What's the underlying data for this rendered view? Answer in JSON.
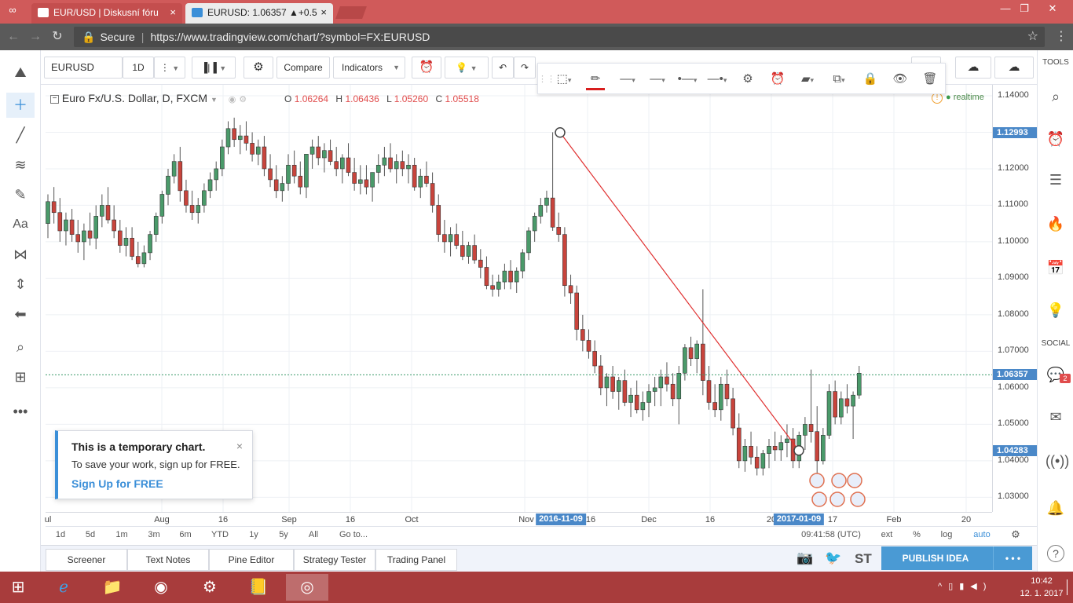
{
  "browser": {
    "tabs": [
      {
        "title": "EUR/USD | Diskusní fóru",
        "close": "×"
      },
      {
        "title": "EURUSD: 1.06357 ▲+0.5",
        "close": "×"
      }
    ],
    "address": {
      "secure_label": "Secure",
      "url": "https://www.tradingview.com/chart/?symbol=FX:EURUSD"
    }
  },
  "toolbar": {
    "symbol": "EURUSD",
    "interval": "1D",
    "compare_label": "Compare",
    "indicators_label": "Indicators"
  },
  "legend": {
    "title": "Euro Fx/U.S. Dollar, D, FXCM",
    "o_label": "O",
    "o": "1.06264",
    "h_label": "H",
    "h": "1.06436",
    "l_label": "L",
    "l": "1.05260",
    "c_label": "C",
    "c": "1.05518",
    "realtime": "realtime"
  },
  "price_scale": {
    "ticks": [
      "1.14000",
      "1.12000",
      "1.11000",
      "1.10000",
      "1.09000",
      "1.08000",
      "1.07000",
      "1.06000",
      "1.05000",
      "1.04000",
      "1.03000"
    ],
    "badges": [
      {
        "label": "1.12993",
        "value": 1.12993,
        "color": "#4a88c8"
      },
      {
        "label": "1.06357",
        "value": 1.06357,
        "color": "#4a88c8"
      },
      {
        "label": "1.04283",
        "value": 1.04283,
        "color": "#4a88c8"
      }
    ]
  },
  "time_scale": {
    "labels": [
      "ul",
      "Aug",
      "16",
      "Sep",
      "16",
      "Oct",
      "Nov",
      "16",
      "Dec",
      "16",
      "20",
      "17",
      "Feb",
      "20"
    ],
    "badges": [
      "2016-11-09",
      "2017-01-09"
    ]
  },
  "popup": {
    "title": "This is a temporary chart.",
    "body": "To save your work, sign up for FREE.",
    "link": "Sign Up for FREE",
    "close": "×"
  },
  "range_bar": {
    "buttons": [
      "1d",
      "5d",
      "1m",
      "3m",
      "6m",
      "YTD",
      "1y",
      "5y",
      "All",
      "Go to..."
    ],
    "time": "09:41:58 (UTC)",
    "options": [
      "ext",
      "%",
      "log",
      "auto"
    ]
  },
  "bottom_tabs": [
    "Screener",
    "Text Notes",
    "Pine Editor",
    "Strategy Tester",
    "Trading Panel"
  ],
  "bottom_right": {
    "st": "ST",
    "publish": "PUBLISH IDEA",
    "more": "• • •"
  },
  "right_sidebar": {
    "tools_label": "TOOLS",
    "social_label": "SOCIAL",
    "chat_badge": "2"
  },
  "taskbar": {
    "time": "10:42",
    "date": "12. 1. 2017"
  },
  "chart_data": {
    "type": "candlestick",
    "title": "Euro Fx/U.S. Dollar, D, FXCM",
    "ylim": [
      1.026,
      1.143
    ],
    "last_price": 1.06357,
    "trendline": {
      "from": {
        "date": "2016-11-09",
        "price": 1.12993
      },
      "to": {
        "date": "2017-01-09",
        "price": 1.04283
      }
    },
    "candles": [
      [
        1.105,
        1.113,
        1.101,
        1.111
      ],
      [
        1.111,
        1.115,
        1.105,
        1.108
      ],
      [
        1.108,
        1.112,
        1.1,
        1.103
      ],
      [
        1.103,
        1.108,
        1.099,
        1.106
      ],
      [
        1.106,
        1.109,
        1.1,
        1.102
      ],
      [
        1.102,
        1.106,
        1.097,
        1.1
      ],
      [
        1.1,
        1.105,
        1.095,
        1.103
      ],
      [
        1.103,
        1.108,
        1.099,
        1.101
      ],
      [
        1.101,
        1.11,
        1.098,
        1.107
      ],
      [
        1.107,
        1.113,
        1.104,
        1.11
      ],
      [
        1.11,
        1.115,
        1.105,
        1.106
      ],
      [
        1.106,
        1.11,
        1.101,
        1.103
      ],
      [
        1.103,
        1.106,
        1.097,
        1.099
      ],
      [
        1.099,
        1.104,
        1.096,
        1.101
      ],
      [
        1.101,
        1.104,
        1.095,
        1.096
      ],
      [
        1.096,
        1.1,
        1.093,
        1.094
      ],
      [
        1.094,
        1.099,
        1.093,
        1.097
      ],
      [
        1.097,
        1.103,
        1.095,
        1.102
      ],
      [
        1.102,
        1.108,
        1.1,
        1.107
      ],
      [
        1.107,
        1.114,
        1.105,
        1.113
      ],
      [
        1.113,
        1.12,
        1.11,
        1.118
      ],
      [
        1.118,
        1.124,
        1.116,
        1.122
      ],
      [
        1.122,
        1.126,
        1.111,
        1.114
      ],
      [
        1.114,
        1.117,
        1.108,
        1.11
      ],
      [
        1.11,
        1.114,
        1.106,
        1.108
      ],
      [
        1.108,
        1.112,
        1.105,
        1.11
      ],
      [
        1.11,
        1.116,
        1.108,
        1.114
      ],
      [
        1.114,
        1.119,
        1.112,
        1.117
      ],
      [
        1.117,
        1.122,
        1.114,
        1.12
      ],
      [
        1.12,
        1.128,
        1.118,
        1.126
      ],
      [
        1.126,
        1.133,
        1.124,
        1.131
      ],
      [
        1.131,
        1.134,
        1.126,
        1.128
      ],
      [
        1.128,
        1.132,
        1.124,
        1.129
      ],
      [
        1.129,
        1.133,
        1.125,
        1.127
      ],
      [
        1.127,
        1.13,
        1.122,
        1.124
      ],
      [
        1.124,
        1.128,
        1.121,
        1.126
      ],
      [
        1.126,
        1.129,
        1.118,
        1.12
      ],
      [
        1.12,
        1.124,
        1.115,
        1.117
      ],
      [
        1.117,
        1.121,
        1.112,
        1.114
      ],
      [
        1.114,
        1.118,
        1.111,
        1.116
      ],
      [
        1.116,
        1.124,
        1.114,
        1.121
      ],
      [
        1.121,
        1.125,
        1.116,
        1.118
      ],
      [
        1.118,
        1.122,
        1.113,
        1.115
      ],
      [
        1.115,
        1.12,
        1.112,
        1.124
      ],
      [
        1.124,
        1.128,
        1.12,
        1.126
      ],
      [
        1.126,
        1.129,
        1.121,
        1.123
      ],
      [
        1.123,
        1.127,
        1.119,
        1.125
      ],
      [
        1.125,
        1.128,
        1.121,
        1.122
      ],
      [
        1.122,
        1.126,
        1.118,
        1.12
      ],
      [
        1.12,
        1.124,
        1.116,
        1.123
      ],
      [
        1.123,
        1.127,
        1.118,
        1.119
      ],
      [
        1.119,
        1.123,
        1.114,
        1.116
      ],
      [
        1.116,
        1.121,
        1.113,
        1.117
      ],
      [
        1.117,
        1.121,
        1.113,
        1.115
      ],
      [
        1.115,
        1.119,
        1.111,
        1.119
      ],
      [
        1.119,
        1.124,
        1.116,
        1.121
      ],
      [
        1.121,
        1.126,
        1.118,
        1.123
      ],
      [
        1.123,
        1.127,
        1.119,
        1.12
      ],
      [
        1.12,
        1.124,
        1.116,
        1.122
      ],
      [
        1.122,
        1.125,
        1.118,
        1.12
      ],
      [
        1.12,
        1.124,
        1.116,
        1.121
      ],
      [
        1.121,
        1.123,
        1.114,
        1.115
      ],
      [
        1.115,
        1.12,
        1.112,
        1.118
      ],
      [
        1.118,
        1.122,
        1.115,
        1.116
      ],
      [
        1.116,
        1.119,
        1.108,
        1.11
      ],
      [
        1.11,
        1.113,
        1.1,
        1.102
      ],
      [
        1.102,
        1.106,
        1.097,
        1.1
      ],
      [
        1.1,
        1.104,
        1.096,
        1.102
      ],
      [
        1.102,
        1.105,
        1.098,
        1.099
      ],
      [
        1.099,
        1.103,
        1.095,
        1.096
      ],
      [
        1.096,
        1.1,
        1.094,
        1.099
      ],
      [
        1.099,
        1.102,
        1.094,
        1.095
      ],
      [
        1.095,
        1.098,
        1.09,
        1.093
      ],
      [
        1.093,
        1.096,
        1.087,
        1.088
      ],
      [
        1.088,
        1.091,
        1.085,
        1.087
      ],
      [
        1.087,
        1.091,
        1.085,
        1.089
      ],
      [
        1.089,
        1.094,
        1.087,
        1.092
      ],
      [
        1.092,
        1.095,
        1.087,
        1.089
      ],
      [
        1.089,
        1.093,
        1.086,
        1.092
      ],
      [
        1.092,
        1.098,
        1.09,
        1.097
      ],
      [
        1.097,
        1.104,
        1.095,
        1.103
      ],
      [
        1.103,
        1.108,
        1.1,
        1.107
      ],
      [
        1.107,
        1.112,
        1.105,
        1.11
      ],
      [
        1.11,
        1.114,
        1.108,
        1.112
      ],
      [
        1.112,
        1.13,
        1.103,
        1.104
      ],
      [
        1.104,
        1.108,
        1.1,
        1.102
      ],
      [
        1.102,
        1.104,
        1.085,
        1.088
      ],
      [
        1.088,
        1.091,
        1.083,
        1.086
      ],
      [
        1.086,
        1.088,
        1.073,
        1.076
      ],
      [
        1.076,
        1.08,
        1.07,
        1.073
      ],
      [
        1.073,
        1.076,
        1.068,
        1.07
      ],
      [
        1.07,
        1.073,
        1.064,
        1.066
      ],
      [
        1.066,
        1.069,
        1.058,
        1.06
      ],
      [
        1.06,
        1.064,
        1.055,
        1.063
      ],
      [
        1.063,
        1.066,
        1.057,
        1.059
      ],
      [
        1.059,
        1.063,
        1.054,
        1.062
      ],
      [
        1.062,
        1.065,
        1.055,
        1.056
      ],
      [
        1.056,
        1.06,
        1.052,
        1.058
      ],
      [
        1.058,
        1.062,
        1.053,
        1.054
      ],
      [
        1.054,
        1.059,
        1.051,
        1.056
      ],
      [
        1.056,
        1.061,
        1.052,
        1.059
      ],
      [
        1.059,
        1.063,
        1.055,
        1.06
      ],
      [
        1.06,
        1.065,
        1.055,
        1.063
      ],
      [
        1.063,
        1.067,
        1.059,
        1.061
      ],
      [
        1.061,
        1.064,
        1.055,
        1.057
      ],
      [
        1.057,
        1.066,
        1.05,
        1.064
      ],
      [
        1.064,
        1.072,
        1.062,
        1.071
      ],
      [
        1.071,
        1.074,
        1.066,
        1.068
      ],
      [
        1.068,
        1.073,
        1.064,
        1.072
      ],
      [
        1.072,
        1.087,
        1.058,
        1.062
      ],
      [
        1.062,
        1.066,
        1.054,
        1.056
      ],
      [
        1.056,
        1.061,
        1.052,
        1.054
      ],
      [
        1.054,
        1.063,
        1.051,
        1.061
      ],
      [
        1.061,
        1.065,
        1.055,
        1.057
      ],
      [
        1.057,
        1.06,
        1.047,
        1.049
      ],
      [
        1.049,
        1.053,
        1.038,
        1.04
      ],
      [
        1.04,
        1.046,
        1.037,
        1.044
      ],
      [
        1.044,
        1.048,
        1.039,
        1.041
      ],
      [
        1.041,
        1.044,
        1.036,
        1.038
      ],
      [
        1.038,
        1.043,
        1.036,
        1.042
      ],
      [
        1.042,
        1.046,
        1.038,
        1.044
      ],
      [
        1.044,
        1.048,
        1.04,
        1.043
      ],
      [
        1.043,
        1.047,
        1.04,
        1.045
      ],
      [
        1.045,
        1.05,
        1.041,
        1.046
      ],
      [
        1.046,
        1.049,
        1.038,
        1.04
      ],
      [
        1.04,
        1.048,
        1.038,
        1.047
      ],
      [
        1.047,
        1.052,
        1.043,
        1.05
      ],
      [
        1.05,
        1.065,
        1.045,
        1.048
      ],
      [
        1.048,
        1.055,
        1.034,
        1.04
      ],
      [
        1.04,
        1.049,
        1.039,
        1.047
      ],
      [
        1.047,
        1.061,
        1.046,
        1.059
      ],
      [
        1.059,
        1.062,
        1.05,
        1.052
      ],
      [
        1.052,
        1.059,
        1.05,
        1.057
      ],
      [
        1.057,
        1.061,
        1.053,
        1.055
      ],
      [
        1.055,
        1.059,
        1.046,
        1.058
      ],
      [
        1.058,
        1.066,
        1.057,
        1.064
      ]
    ]
  }
}
